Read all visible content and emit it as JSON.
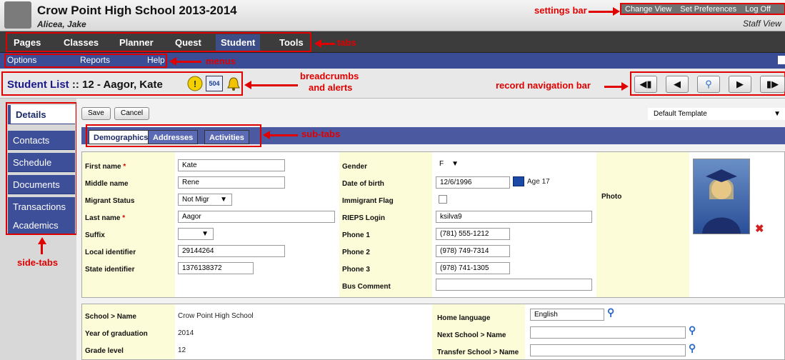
{
  "header": {
    "school": "Crow Point High School 2013-2014",
    "user": "Alicea, Jake",
    "settings": [
      "Change View",
      "Set Preferences",
      "Log Off"
    ],
    "view": "Staff View"
  },
  "tabs": [
    "Pages",
    "Classes",
    "Planner",
    "Quest",
    "Student",
    "Tools"
  ],
  "menus": [
    "Options",
    "Reports",
    "Help"
  ],
  "breadcrumb": {
    "link": "Student List",
    "rest": " :: 12 - Aagor, Kate"
  },
  "alerts": {
    "badge504": "504"
  },
  "annotations": {
    "settings_bar": "settings bar",
    "tabs": "tabs",
    "menus": "menus",
    "breadcrumbs": "breadcrumbs",
    "and_alerts": "and alerts",
    "record_nav": "record navigation bar",
    "sub_tabs": "sub-tabs",
    "side_tabs": "side-tabs"
  },
  "side_tabs": [
    "Details",
    "Contacts",
    "Schedule",
    "Documents",
    "Transactions",
    "Academics"
  ],
  "toolbar": {
    "save": "Save",
    "cancel": "Cancel",
    "template": "Default Template"
  },
  "sub_tabs": [
    "Demographics",
    "Addresses",
    "Activities"
  ],
  "form": {
    "first_name": {
      "label": "First name",
      "value": "Kate"
    },
    "middle_name": {
      "label": "Middle name",
      "value": "Rene"
    },
    "migrant_status": {
      "label": "Migrant Status",
      "value": "Not Migr"
    },
    "last_name": {
      "label": "Last name",
      "value": "Aagor"
    },
    "suffix": {
      "label": "Suffix",
      "value": ""
    },
    "local_identifier": {
      "label": "Local identifier",
      "value": "29144264"
    },
    "state_identifier": {
      "label": "State identifier",
      "value": "1376138372"
    },
    "gender": {
      "label": "Gender",
      "value": "F"
    },
    "dob": {
      "label": "Date of birth",
      "value": "12/6/1996",
      "age": "Age 17"
    },
    "immigrant_flag": {
      "label": "Immigrant Flag"
    },
    "rieps_login": {
      "label": "RIEPS Login",
      "value": "ksilva9"
    },
    "phone1": {
      "label": "Phone 1",
      "value": "(781) 555-1212"
    },
    "phone2": {
      "label": "Phone 2",
      "value": "(978) 749-7314"
    },
    "phone3": {
      "label": "Phone 3",
      "value": "(978) 741-1305"
    },
    "bus_comment": {
      "label": "Bus Comment",
      "value": ""
    },
    "photo": {
      "label": "Photo"
    }
  },
  "school_info": {
    "school_name": {
      "label": "School > Name",
      "value": "Crow Point High School"
    },
    "graduation": {
      "label": "Year of graduation",
      "value": "2014"
    },
    "grade": {
      "label": "Grade level",
      "value": "12"
    },
    "home_language": {
      "label": "Home language",
      "value": "English"
    },
    "next_school": {
      "label": "Next School > Name",
      "value": ""
    },
    "transfer_school": {
      "label": "Transfer School > Name",
      "value": ""
    }
  },
  "colors": {
    "accent_blue": "#3a4c95",
    "annotation_red": "#e00000",
    "field_yellow": "#fdfcd8"
  }
}
